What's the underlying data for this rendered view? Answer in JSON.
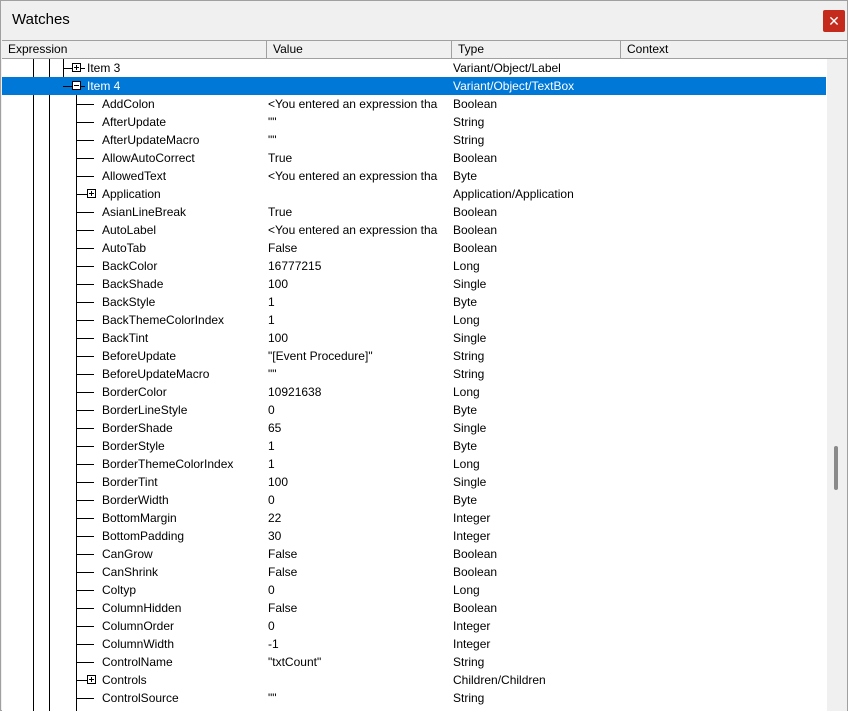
{
  "window": {
    "title": "Watches",
    "close_glyph": "✕"
  },
  "columns": {
    "expression": "Expression",
    "value": "Value",
    "type": "Type",
    "context": "Context"
  },
  "rows": [
    {
      "expr": "Item 3",
      "value": "",
      "type": "Variant/Object/Label",
      "level": 2,
      "expander": "plus"
    },
    {
      "expr": "Item 4",
      "value": "",
      "type": "Variant/Object/TextBox",
      "level": 2,
      "expander": "minus",
      "selected": true
    },
    {
      "expr": "AddColon",
      "value": "<You entered an expression tha",
      "type": "Boolean",
      "level": 3
    },
    {
      "expr": "AfterUpdate",
      "value": "\"\"",
      "type": "String",
      "level": 3
    },
    {
      "expr": "AfterUpdateMacro",
      "value": "\"\"",
      "type": "String",
      "level": 3
    },
    {
      "expr": "AllowAutoCorrect",
      "value": "True",
      "type": "Boolean",
      "level": 3
    },
    {
      "expr": "AllowedText",
      "value": "<You entered an expression tha",
      "type": "Byte",
      "level": 3
    },
    {
      "expr": "Application",
      "value": "",
      "type": "Application/Application",
      "level": 3,
      "expander": "plus"
    },
    {
      "expr": "AsianLineBreak",
      "value": "True",
      "type": "Boolean",
      "level": 3
    },
    {
      "expr": "AutoLabel",
      "value": "<You entered an expression tha",
      "type": "Boolean",
      "level": 3
    },
    {
      "expr": "AutoTab",
      "value": "False",
      "type": "Boolean",
      "level": 3
    },
    {
      "expr": "BackColor",
      "value": "16777215",
      "type": "Long",
      "level": 3
    },
    {
      "expr": "BackShade",
      "value": "100",
      "type": "Single",
      "level": 3
    },
    {
      "expr": "BackStyle",
      "value": "1",
      "type": "Byte",
      "level": 3
    },
    {
      "expr": "BackThemeColorIndex",
      "value": "1",
      "type": "Long",
      "level": 3
    },
    {
      "expr": "BackTint",
      "value": "100",
      "type": "Single",
      "level": 3
    },
    {
      "expr": "BeforeUpdate",
      "value": "\"[Event Procedure]\"",
      "type": "String",
      "level": 3
    },
    {
      "expr": "BeforeUpdateMacro",
      "value": "\"\"",
      "type": "String",
      "level": 3
    },
    {
      "expr": "BorderColor",
      "value": "10921638",
      "type": "Long",
      "level": 3
    },
    {
      "expr": "BorderLineStyle",
      "value": "0",
      "type": "Byte",
      "level": 3
    },
    {
      "expr": "BorderShade",
      "value": "65",
      "type": "Single",
      "level": 3
    },
    {
      "expr": "BorderStyle",
      "value": "1",
      "type": "Byte",
      "level": 3
    },
    {
      "expr": "BorderThemeColorIndex",
      "value": "1",
      "type": "Long",
      "level": 3
    },
    {
      "expr": "BorderTint",
      "value": "100",
      "type": "Single",
      "level": 3
    },
    {
      "expr": "BorderWidth",
      "value": "0",
      "type": "Byte",
      "level": 3
    },
    {
      "expr": "BottomMargin",
      "value": "22",
      "type": "Integer",
      "level": 3
    },
    {
      "expr": "BottomPadding",
      "value": "30",
      "type": "Integer",
      "level": 3
    },
    {
      "expr": "CanGrow",
      "value": "False",
      "type": "Boolean",
      "level": 3
    },
    {
      "expr": "CanShrink",
      "value": "False",
      "type": "Boolean",
      "level": 3
    },
    {
      "expr": "Coltyp",
      "value": "0",
      "type": "Long",
      "level": 3
    },
    {
      "expr": "ColumnHidden",
      "value": "False",
      "type": "Boolean",
      "level": 3
    },
    {
      "expr": "ColumnOrder",
      "value": "0",
      "type": "Integer",
      "level": 3
    },
    {
      "expr": "ColumnWidth",
      "value": "-1",
      "type": "Integer",
      "level": 3
    },
    {
      "expr": "ControlName",
      "value": "\"txtCount\"",
      "type": "String",
      "level": 3
    },
    {
      "expr": "Controls",
      "value": "",
      "type": "Children/Children",
      "level": 3,
      "expander": "plus"
    },
    {
      "expr": "ControlSource",
      "value": "\"\"",
      "type": "String",
      "level": 3
    }
  ]
}
